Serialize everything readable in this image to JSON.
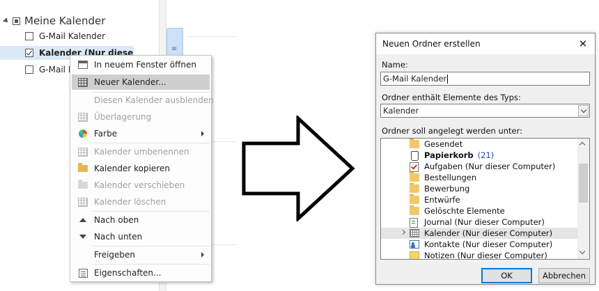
{
  "calendar_pane": {
    "group_label": "Meine Kalender",
    "items": [
      {
        "label": "G-Mail Kalender",
        "checked": false,
        "selected": false
      },
      {
        "label": "Kalender (Nur dieser Comp",
        "checked": true,
        "selected": true
      },
      {
        "label": "G-Mail K",
        "checked": false,
        "selected": false
      }
    ],
    "side_tab_glyph": "≡"
  },
  "context_menu": {
    "items": [
      {
        "label": "In neuem Fenster öffnen",
        "icon": "new-window-icon",
        "enabled": true
      },
      {
        "label": "Neuer Kalender...",
        "icon": "calendar-grid-icon",
        "enabled": true,
        "highlighted": true
      },
      {
        "label": "Diesen Kalender ausblenden",
        "icon": "",
        "enabled": false
      },
      {
        "label": "Überlagerung",
        "icon": "overlay-icon",
        "enabled": false
      },
      {
        "label": "Farbe",
        "icon": "color-palette-icon",
        "enabled": true,
        "submenu": true
      },
      {
        "label": "Kalender umbenennen",
        "icon": "rename-icon",
        "enabled": false
      },
      {
        "label": "Kalender kopieren",
        "icon": "copy-folder-icon",
        "enabled": true
      },
      {
        "label": "Kalender verschieben",
        "icon": "move-folder-icon",
        "enabled": false
      },
      {
        "label": "Kalender löschen",
        "icon": "delete-icon",
        "enabled": false
      },
      {
        "label": "Nach oben",
        "icon": "arrow-up-icon",
        "enabled": true
      },
      {
        "label": "Nach unten",
        "icon": "arrow-down-icon",
        "enabled": true
      },
      {
        "label": "Freigeben",
        "icon": "",
        "enabled": true,
        "submenu": true
      },
      {
        "label": "Eigenschaften...",
        "icon": "properties-icon",
        "enabled": true
      }
    ]
  },
  "dialog": {
    "title": "Neuen Ordner erstellen",
    "close_glyph": "✕",
    "name_label": "Name:",
    "name_value": "G-Mail Kalender",
    "type_label": "Ordner enthält Elemente des Typs:",
    "type_value": "Kalender",
    "location_label": "Ordner soll angelegt werden unter:",
    "folders": [
      {
        "label": "Gesendet",
        "icon": "folder-icon"
      },
      {
        "label": "Papierkorb",
        "count": "(21)",
        "icon": "trash-icon",
        "bold": true
      },
      {
        "label": "Aufgaben (Nur dieser Computer)",
        "icon": "tasks-icon"
      },
      {
        "label": "Bestellungen",
        "icon": "folder-icon"
      },
      {
        "label": "Bewerbung",
        "icon": "folder-icon"
      },
      {
        "label": "Entwürfe",
        "icon": "folder-icon"
      },
      {
        "label": "Gelöschte Elemente",
        "icon": "folder-icon"
      },
      {
        "label": "Journal (Nur dieser Computer)",
        "icon": "journal-icon"
      },
      {
        "label": "Kalender (Nur dieser Computer)",
        "icon": "calendar-icon",
        "selected": true,
        "expandable": true
      },
      {
        "label": "Kontakte (Nur dieser Computer)",
        "icon": "contacts-icon"
      },
      {
        "label": "Notizen (Nur dieser Computer)",
        "icon": "notes-icon"
      }
    ],
    "ok_label": "OK",
    "cancel_label": "Abbrechen"
  },
  "colors": {
    "menu_highlight": "#cfcfcf",
    "selection": "#dbe9f6",
    "accent": "#0078d7",
    "count_blue": "#1f4fa5"
  }
}
